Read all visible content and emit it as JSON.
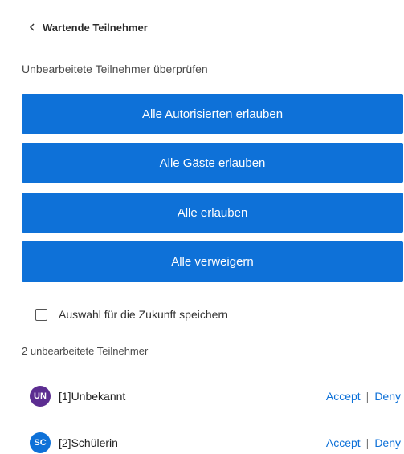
{
  "header": {
    "back_label": "Wartende Teilnehmer"
  },
  "subtitle": "Unbearbeitete Teilnehmer überprüfen",
  "buttons": {
    "allow_authorized": "Alle Autorisierten erlauben",
    "allow_guests": "Alle Gäste erlauben",
    "allow_all": "Alle erlauben",
    "deny_all": "Alle verweigern"
  },
  "remember": {
    "label": "Auswahl für die Zukunft speichern",
    "checked": false
  },
  "participant_count": "2 unbearbeitete Teilnehmer",
  "participants": [
    {
      "initials": "UN",
      "name": "[1]Unbekannt",
      "avatar_color": "#5c2d91",
      "accept": "Accept",
      "separator": "|",
      "deny": "Deny"
    },
    {
      "initials": "SC",
      "name": "[2]Schülerin",
      "avatar_color": "#0e71d8",
      "accept": "Accept",
      "separator": "|",
      "deny": "Deny"
    }
  ],
  "colors": {
    "accent": "#0e71d8"
  }
}
